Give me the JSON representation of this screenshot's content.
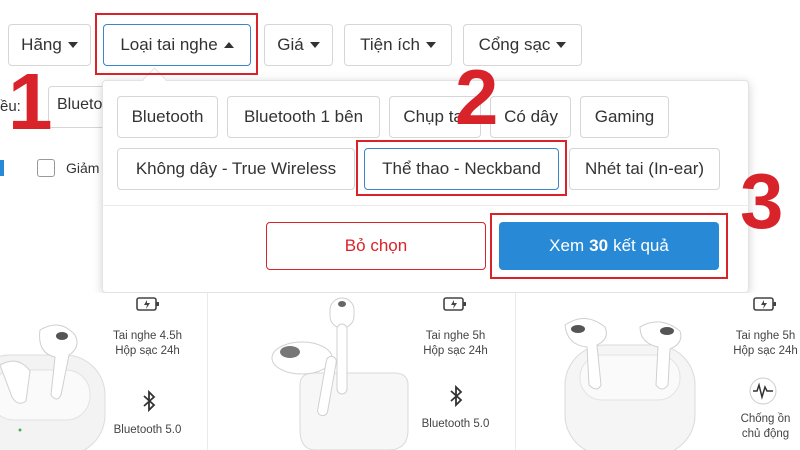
{
  "filters": {
    "brand": "Hãng",
    "earphone_type": "Loại tai nghe",
    "price": "Giá",
    "utility": "Tiện ích",
    "charging_port": "Cổng sạc"
  },
  "background": {
    "label_left": "ều:",
    "field_left": "Blueto",
    "discount_label": "Giảm"
  },
  "options": [
    "Bluetooth",
    "Bluetooth 1 bên",
    "Chụp tai",
    "Có dây",
    "Gaming",
    "Không dây - True Wireless",
    "Thể thao - Neckband",
    "Nhét tai (In-ear)"
  ],
  "actions": {
    "clear": "Bỏ chọn",
    "view_prefix": "Xem",
    "view_count": "30",
    "view_suffix": "kết quả"
  },
  "steps": [
    "1",
    "2",
    "3"
  ],
  "products": [
    {
      "battery": "Tai nghe 4.5h",
      "case": "Hộp sạc 24h",
      "feature": "Bluetooth 5.0"
    },
    {
      "battery": "Tai nghe 5h",
      "case": "Hộp sạc 24h",
      "feature": "Bluetooth 5.0"
    },
    {
      "battery": "Tai nghe 5h",
      "case": "Hộp sạc 24h",
      "feature": "Chống ồn",
      "feature2": "chủ động"
    }
  ],
  "colors": {
    "accent": "#288ad6",
    "highlight": "#d8232a"
  }
}
